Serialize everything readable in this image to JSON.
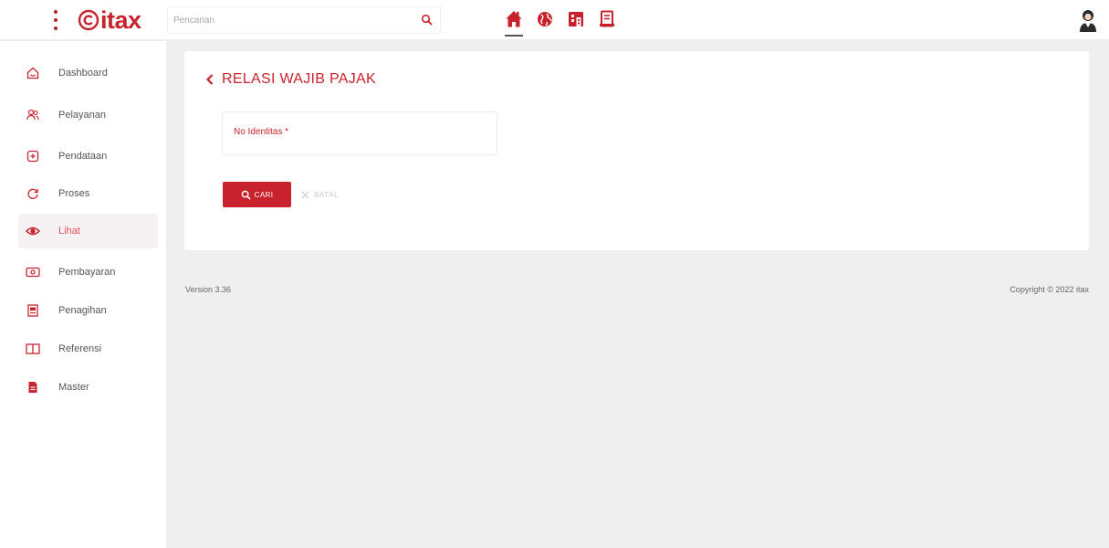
{
  "brand": {
    "name": "itax",
    "color": "#c8232c"
  },
  "search": {
    "placeholder": "Pencarian",
    "value": ""
  },
  "top_nav": [
    {
      "name": "home",
      "icon": "home-icon",
      "active": true
    },
    {
      "name": "globe",
      "icon": "globe-icon",
      "active": false
    },
    {
      "name": "building",
      "icon": "building-icon",
      "active": false
    },
    {
      "name": "document",
      "icon": "document-icon",
      "active": false
    }
  ],
  "sidebar": {
    "items": [
      {
        "label": "Dashboard",
        "icon": "home-outline-icon"
      },
      {
        "label": "Pelayanan",
        "icon": "users-icon"
      },
      {
        "label": "Pendataan",
        "icon": "add-box-icon"
      },
      {
        "label": "Proses",
        "icon": "refresh-icon"
      },
      {
        "label": "Lihat",
        "icon": "eye-icon",
        "active": true
      },
      {
        "label": "Pembayaran",
        "icon": "payment-icon"
      },
      {
        "label": "Penagihan",
        "icon": "invoice-icon"
      },
      {
        "label": "Referensi",
        "icon": "book-icon"
      },
      {
        "label": "Master",
        "icon": "file-icon"
      }
    ]
  },
  "page": {
    "title": "RELASI WAJIB PAJAK",
    "field_label": "No Identitas *",
    "field_value": "",
    "cari_label": "CARI",
    "batal_label": "BATAL"
  },
  "footer": {
    "version": "Version 3.36",
    "copyright": "Copyright © 2022 itax"
  }
}
